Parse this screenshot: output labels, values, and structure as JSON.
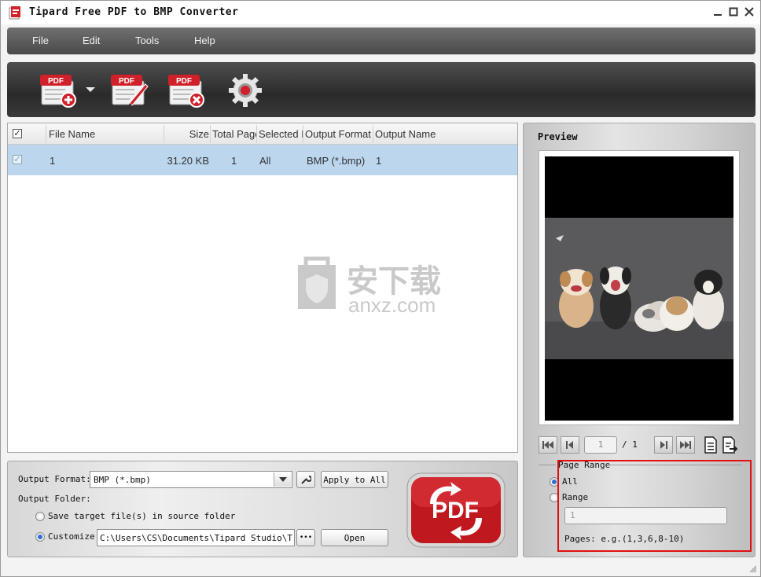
{
  "window": {
    "title": "Tipard Free PDF to BMP Converter",
    "controls": {
      "minimize": "−",
      "maximize": "□",
      "close": "✕"
    }
  },
  "menu": {
    "items": [
      {
        "label": "File"
      },
      {
        "label": "Edit"
      },
      {
        "label": "Tools"
      },
      {
        "label": "Help"
      }
    ]
  },
  "toolbar": {
    "buttons": [
      {
        "icon": "add-pdf-icon",
        "icon_text": "PDF"
      },
      {
        "icon": "edit-pdf-icon",
        "icon_text": "PDF"
      },
      {
        "icon": "remove-pdf-icon",
        "icon_text": "PDF"
      },
      {
        "icon": "settings-gear-icon"
      }
    ]
  },
  "file_list": {
    "columns": [
      "File Name",
      "Size",
      "Total Pages",
      "Selected Pages",
      "Output Format",
      "Output Name"
    ],
    "rows": [
      {
        "checked": true,
        "file_name": "1",
        "size": "31.20 KB",
        "total_pages": "1",
        "selected_pages": "All",
        "output_format": "BMP (*.bmp)",
        "output_name": "1"
      }
    ]
  },
  "watermark": {
    "cn_text": "安下载",
    "en_text": "anxz.com"
  },
  "output": {
    "format_label": "Output Format:",
    "format_value": "BMP (*.bmp)",
    "apply_all_label": "Apply to All",
    "folder_label": "Output Folder:",
    "save_source_label": "Save target file(s) in source folder",
    "customize_label": "Customize:",
    "path_value": "C:\\Users\\CS\\Documents\\Tipard Studio\\Tipar",
    "browse_label": "•••",
    "open_label": "Open",
    "selected_folder_option": "customize",
    "convert_label": "PDF"
  },
  "preview": {
    "label": "Preview",
    "current_page": "1",
    "total_pages": "/ 1"
  },
  "page_range": {
    "title": "Page Range",
    "all_label": "All",
    "range_label": "Range",
    "range_placeholder": "1",
    "hint": "Pages: e.g.(1,3,6,8-10)",
    "selected": "all"
  },
  "colors": {
    "accent_red": "#d0212a",
    "selection_blue": "#bcd6ee",
    "highlight_box": "#e01010"
  }
}
